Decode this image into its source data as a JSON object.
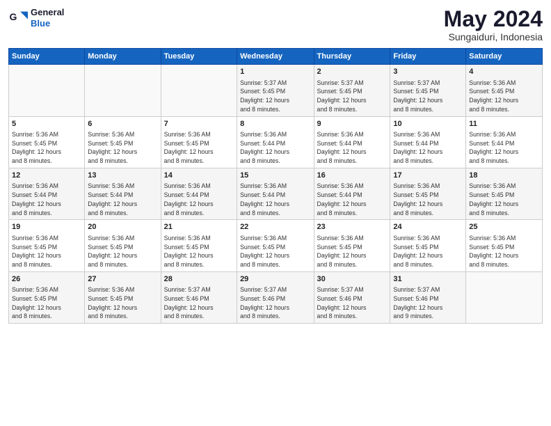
{
  "header": {
    "logo_line1": "General",
    "logo_line2": "Blue",
    "main_title": "May 2024",
    "sub_title": "Sungaiduri, Indonesia"
  },
  "days_of_week": [
    "Sunday",
    "Monday",
    "Tuesday",
    "Wednesday",
    "Thursday",
    "Friday",
    "Saturday"
  ],
  "weeks": [
    [
      {
        "day": "",
        "info": ""
      },
      {
        "day": "",
        "info": ""
      },
      {
        "day": "",
        "info": ""
      },
      {
        "day": "1",
        "info": "Sunrise: 5:37 AM\nSunset: 5:45 PM\nDaylight: 12 hours\nand 8 minutes."
      },
      {
        "day": "2",
        "info": "Sunrise: 5:37 AM\nSunset: 5:45 PM\nDaylight: 12 hours\nand 8 minutes."
      },
      {
        "day": "3",
        "info": "Sunrise: 5:37 AM\nSunset: 5:45 PM\nDaylight: 12 hours\nand 8 minutes."
      },
      {
        "day": "4",
        "info": "Sunrise: 5:36 AM\nSunset: 5:45 PM\nDaylight: 12 hours\nand 8 minutes."
      }
    ],
    [
      {
        "day": "5",
        "info": "Sunrise: 5:36 AM\nSunset: 5:45 PM\nDaylight: 12 hours\nand 8 minutes."
      },
      {
        "day": "6",
        "info": "Sunrise: 5:36 AM\nSunset: 5:45 PM\nDaylight: 12 hours\nand 8 minutes."
      },
      {
        "day": "7",
        "info": "Sunrise: 5:36 AM\nSunset: 5:45 PM\nDaylight: 12 hours\nand 8 minutes."
      },
      {
        "day": "8",
        "info": "Sunrise: 5:36 AM\nSunset: 5:44 PM\nDaylight: 12 hours\nand 8 minutes."
      },
      {
        "day": "9",
        "info": "Sunrise: 5:36 AM\nSunset: 5:44 PM\nDaylight: 12 hours\nand 8 minutes."
      },
      {
        "day": "10",
        "info": "Sunrise: 5:36 AM\nSunset: 5:44 PM\nDaylight: 12 hours\nand 8 minutes."
      },
      {
        "day": "11",
        "info": "Sunrise: 5:36 AM\nSunset: 5:44 PM\nDaylight: 12 hours\nand 8 minutes."
      }
    ],
    [
      {
        "day": "12",
        "info": "Sunrise: 5:36 AM\nSunset: 5:44 PM\nDaylight: 12 hours\nand 8 minutes."
      },
      {
        "day": "13",
        "info": "Sunrise: 5:36 AM\nSunset: 5:44 PM\nDaylight: 12 hours\nand 8 minutes."
      },
      {
        "day": "14",
        "info": "Sunrise: 5:36 AM\nSunset: 5:44 PM\nDaylight: 12 hours\nand 8 minutes."
      },
      {
        "day": "15",
        "info": "Sunrise: 5:36 AM\nSunset: 5:44 PM\nDaylight: 12 hours\nand 8 minutes."
      },
      {
        "day": "16",
        "info": "Sunrise: 5:36 AM\nSunset: 5:44 PM\nDaylight: 12 hours\nand 8 minutes."
      },
      {
        "day": "17",
        "info": "Sunrise: 5:36 AM\nSunset: 5:45 PM\nDaylight: 12 hours\nand 8 minutes."
      },
      {
        "day": "18",
        "info": "Sunrise: 5:36 AM\nSunset: 5:45 PM\nDaylight: 12 hours\nand 8 minutes."
      }
    ],
    [
      {
        "day": "19",
        "info": "Sunrise: 5:36 AM\nSunset: 5:45 PM\nDaylight: 12 hours\nand 8 minutes."
      },
      {
        "day": "20",
        "info": "Sunrise: 5:36 AM\nSunset: 5:45 PM\nDaylight: 12 hours\nand 8 minutes."
      },
      {
        "day": "21",
        "info": "Sunrise: 5:36 AM\nSunset: 5:45 PM\nDaylight: 12 hours\nand 8 minutes."
      },
      {
        "day": "22",
        "info": "Sunrise: 5:36 AM\nSunset: 5:45 PM\nDaylight: 12 hours\nand 8 minutes."
      },
      {
        "day": "23",
        "info": "Sunrise: 5:36 AM\nSunset: 5:45 PM\nDaylight: 12 hours\nand 8 minutes."
      },
      {
        "day": "24",
        "info": "Sunrise: 5:36 AM\nSunset: 5:45 PM\nDaylight: 12 hours\nand 8 minutes."
      },
      {
        "day": "25",
        "info": "Sunrise: 5:36 AM\nSunset: 5:45 PM\nDaylight: 12 hours\nand 8 minutes."
      }
    ],
    [
      {
        "day": "26",
        "info": "Sunrise: 5:36 AM\nSunset: 5:45 PM\nDaylight: 12 hours\nand 8 minutes."
      },
      {
        "day": "27",
        "info": "Sunrise: 5:36 AM\nSunset: 5:45 PM\nDaylight: 12 hours\nand 8 minutes."
      },
      {
        "day": "28",
        "info": "Sunrise: 5:37 AM\nSunset: 5:46 PM\nDaylight: 12 hours\nand 8 minutes."
      },
      {
        "day": "29",
        "info": "Sunrise: 5:37 AM\nSunset: 5:46 PM\nDaylight: 12 hours\nand 8 minutes."
      },
      {
        "day": "30",
        "info": "Sunrise: 5:37 AM\nSunset: 5:46 PM\nDaylight: 12 hours\nand 8 minutes."
      },
      {
        "day": "31",
        "info": "Sunrise: 5:37 AM\nSunset: 5:46 PM\nDaylight: 12 hours\nand 9 minutes."
      },
      {
        "day": "",
        "info": ""
      }
    ]
  ]
}
